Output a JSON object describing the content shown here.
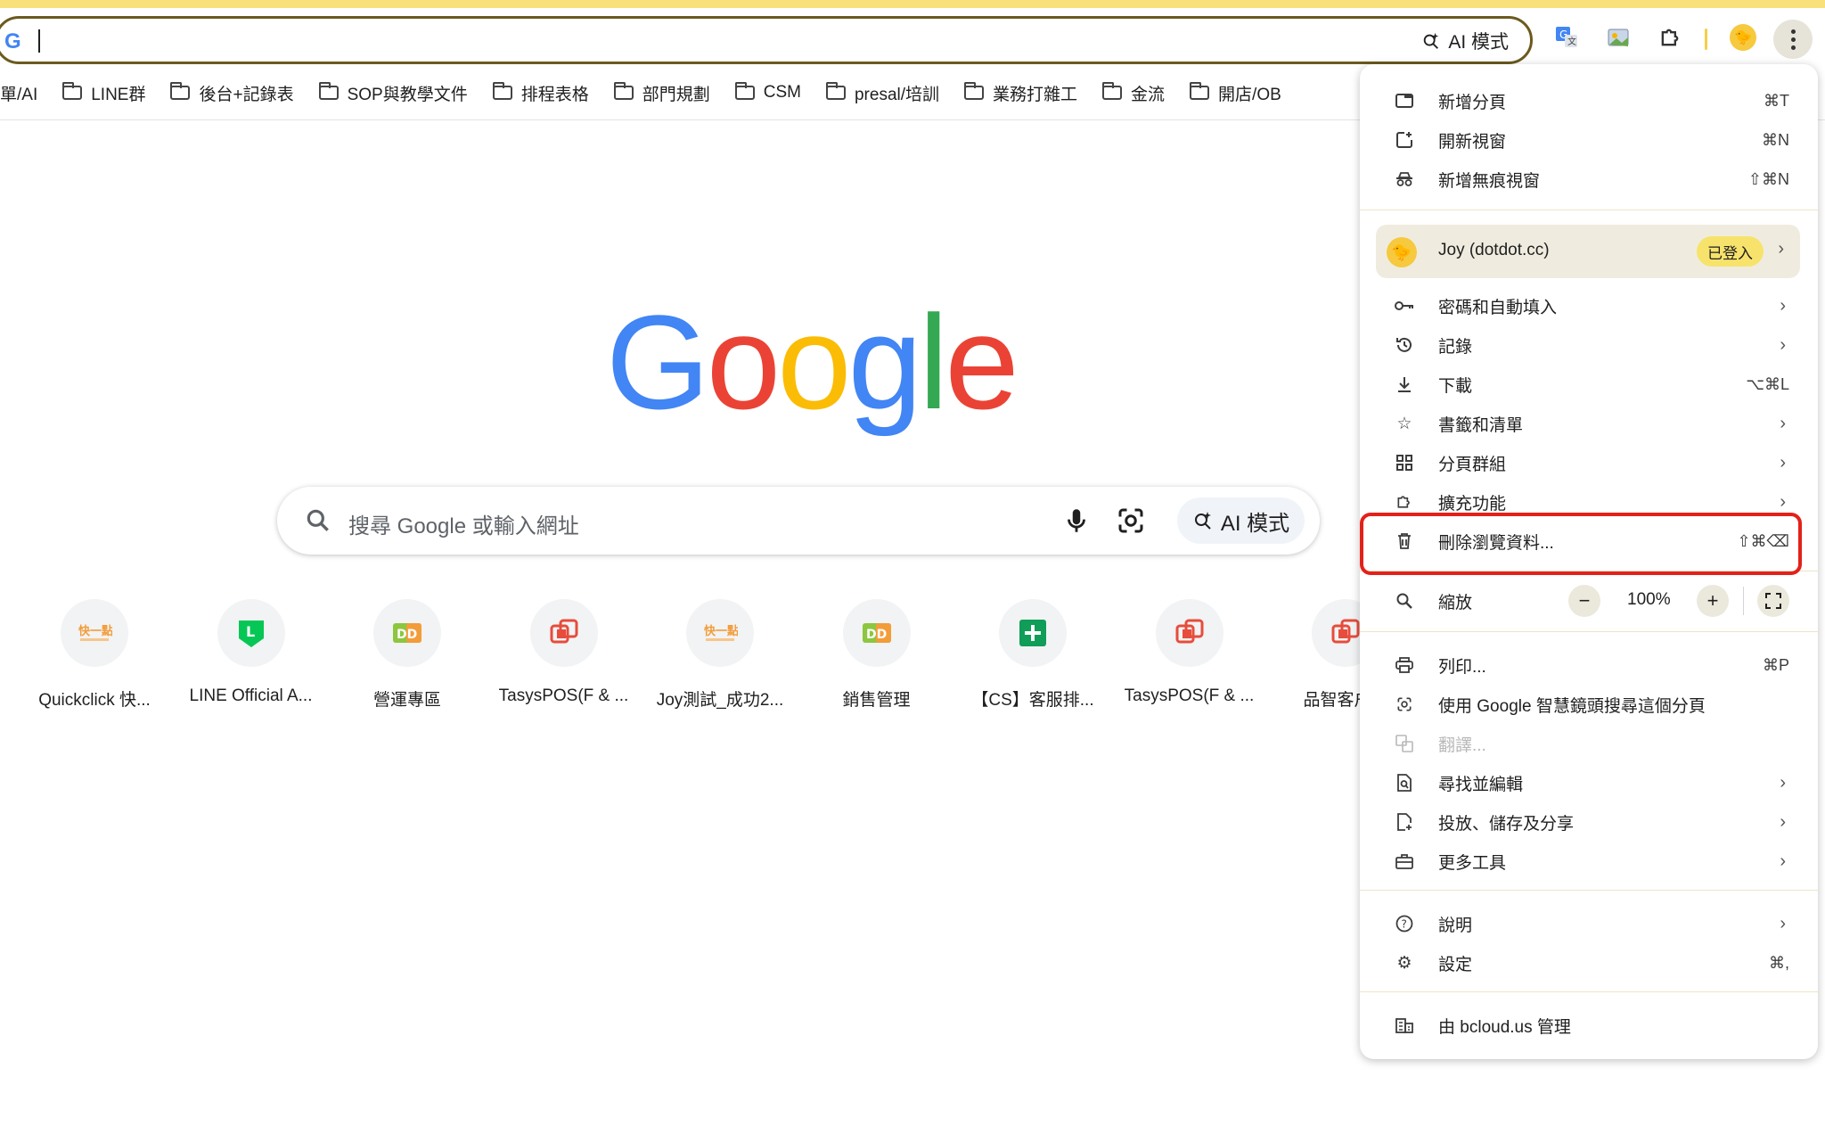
{
  "omnibox": {
    "ai_mode_label": "AI 模式"
  },
  "bookmarks": [
    {
      "label": "單/AI",
      "folder": false
    },
    {
      "label": "LINE群",
      "folder": true
    },
    {
      "label": "後台+記錄表",
      "folder": true
    },
    {
      "label": "SOP與教學文件",
      "folder": true
    },
    {
      "label": "排程表格",
      "folder": true
    },
    {
      "label": "部門規劃",
      "folder": true
    },
    {
      "label": "CSM",
      "folder": true
    },
    {
      "label": "presal/培訓",
      "folder": true
    },
    {
      "label": "業務打雜工",
      "folder": true
    },
    {
      "label": "金流",
      "folder": true
    },
    {
      "label": "開店/OB",
      "folder": true
    }
  ],
  "google_logo": [
    "G",
    "o",
    "o",
    "g",
    "l",
    "e"
  ],
  "search": {
    "placeholder": "搜尋 Google 或輸入網址",
    "ai_mode_label": "AI 模式"
  },
  "shortcuts": [
    {
      "label": "Quickclick 快...",
      "icon": "quickclick-icon"
    },
    {
      "label": "LINE Official A...",
      "icon": "line-icon"
    },
    {
      "label": "營運專區",
      "icon": "dd-icon"
    },
    {
      "label": "TasysPOS(F & ...",
      "icon": "tasys-icon"
    },
    {
      "label": "Joy測試_成功2...",
      "icon": "quickclick-icon"
    },
    {
      "label": "銷售管理",
      "icon": "dd-icon"
    },
    {
      "label": "【CS】客服排...",
      "icon": "sheets-icon"
    },
    {
      "label": "TasysPOS(F & ...",
      "icon": "tasys-icon"
    },
    {
      "label": "品智客户运",
      "icon": "tasys-icon"
    }
  ],
  "menu": {
    "new_tab": {
      "label": "新增分頁",
      "shortcut": "⌘T"
    },
    "new_window": {
      "label": "開新視窗",
      "shortcut": "⌘N"
    },
    "new_incognito": {
      "label": "新增無痕視窗",
      "shortcut": "⇧⌘N"
    },
    "profile": {
      "name": "Joy (dotdot.cc)",
      "badge": "已登入"
    },
    "passwords": {
      "label": "密碼和自動填入"
    },
    "history": {
      "label": "記錄"
    },
    "downloads": {
      "label": "下載",
      "shortcut": "⌥⌘L"
    },
    "bookmarks_lists": {
      "label": "書籤和清單"
    },
    "tab_groups": {
      "label": "分頁群組"
    },
    "extensions": {
      "label": "擴充功能"
    },
    "clear_data": {
      "label": "刪除瀏覽資料...",
      "shortcut": "⇧⌘⌫"
    },
    "zoom": {
      "label": "縮放",
      "value": "100%",
      "minus": "−",
      "plus": "+"
    },
    "print": {
      "label": "列印...",
      "shortcut": "⌘P"
    },
    "lens": {
      "label": "使用 Google 智慧鏡頭搜尋這個分頁"
    },
    "translate": {
      "label": "翻譯..."
    },
    "find_edit": {
      "label": "尋找並編輯"
    },
    "cast_save_share": {
      "label": "投放、儲存及分享"
    },
    "more_tools": {
      "label": "更多工具"
    },
    "help": {
      "label": "說明"
    },
    "settings": {
      "label": "設定",
      "shortcut": "⌘,"
    },
    "managed_by": {
      "label": "由 bcloud.us 管理"
    }
  },
  "colors": {
    "google_blue": "#4285f4",
    "google_red": "#ea4335",
    "google_yellow": "#fbbc05",
    "google_green": "#34a853",
    "highlight_red": "#e3211b",
    "accent_yellow": "#f9e07a"
  }
}
